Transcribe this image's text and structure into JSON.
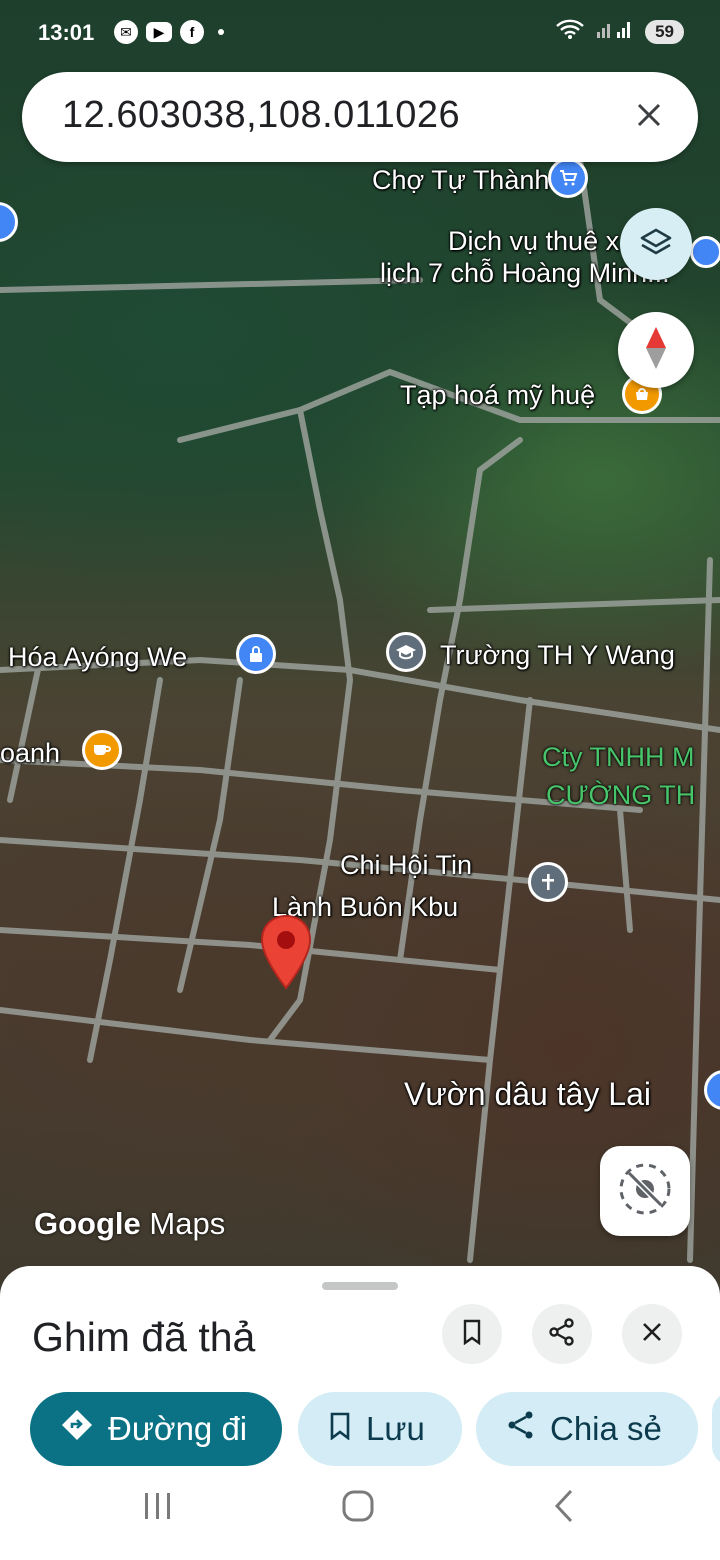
{
  "status_bar": {
    "time": "13:01",
    "app_icons": [
      "messenger-icon",
      "youtube-icon",
      "facebook-icon"
    ],
    "battery": "59"
  },
  "search": {
    "query": "12.603038,108.011026",
    "clear_icon": "close-icon"
  },
  "map": {
    "labels": {
      "cho_tu_thanh": "Chợ Tự Thành",
      "dich_vu_line1": "Dịch vụ thuê x",
      "dich_vu_line2": "lịch 7 chỗ Hoàng Minh...",
      "tap_hoa": "Tạp hoá mỹ huệ",
      "hoa_ayong": "Hóa Ayóng We",
      "truong": "Trường TH Y Wang",
      "banh": "oanh",
      "cty_line1": "Cty TNHH M",
      "cty_line2": "CƯỜNG TH",
      "chi_hoi_line1": "Chi Hội Tin",
      "chi_hoi_line2": "Lành Buôn Kbu",
      "vuon_dau": "Vườn dâu tây Lai"
    },
    "watermark_google": "Google",
    "watermark_maps": "Maps"
  },
  "sheet": {
    "title": "Ghim đã thả",
    "directions_label": "Đường đi",
    "save_label": "Lưu",
    "share_label": "Chia sẻ"
  },
  "colors": {
    "primary": "#0b7285",
    "chip_bg": "#d3ecf6",
    "pin": "#ea4335",
    "poi_blue": "#4285f4",
    "poi_orange": "#f29900"
  }
}
